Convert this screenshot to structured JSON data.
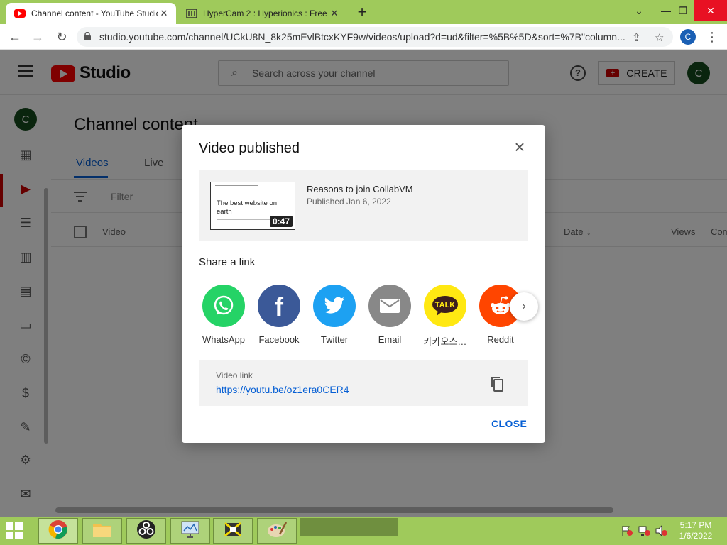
{
  "browser": {
    "tabs": [
      {
        "title": "Channel content - YouTube Studio",
        "active": true
      },
      {
        "title": "HyperCam 2 : Hyperionics : Free",
        "active": false
      }
    ],
    "url": "studio.youtube.com/channel/UCkU8N_8k25mEvlBtcxKYF9w/videos/upload?d=ud&filter=%5B%5D&sort=%7B\"column...",
    "profile_initial": "C"
  },
  "studio": {
    "logo_text": "Studio",
    "search_placeholder": "Search across your channel",
    "create_label": "CREATE",
    "avatar_initial": "C",
    "channel_initial": "C",
    "page_title": "Channel content",
    "tabs": [
      "Videos",
      "Live"
    ],
    "filter_label": "Filter",
    "columns": {
      "video": "Video",
      "date": "Date",
      "views": "Views",
      "comments": "Com"
    }
  },
  "dialog": {
    "title": "Video published",
    "video": {
      "name": "Reasons to join CollabVM",
      "published": "Published Jan 6, 2022",
      "thumb_text": "The best website on earth",
      "duration": "0:47"
    },
    "share_heading": "Share a link",
    "share_targets": [
      {
        "label": "WhatsApp",
        "color": "#25d366"
      },
      {
        "label": "Facebook",
        "color": "#3b5998"
      },
      {
        "label": "Twitter",
        "color": "#1da1f2"
      },
      {
        "label": "Email",
        "color": "#888888"
      },
      {
        "label": "카카오스…",
        "color": "#ffe812"
      },
      {
        "label": "Reddit",
        "color": "#ff4500"
      }
    ],
    "link_label": "Video link",
    "link_url": "https://youtu.be/oz1era0CER4",
    "close_label": "CLOSE"
  },
  "taskbar": {
    "time": "5:17 PM",
    "date": "1/6/2022"
  },
  "colors": {
    "accent": "#065fd4",
    "brand_red": "#ff0000",
    "chrome_green": "#9fca5b"
  }
}
